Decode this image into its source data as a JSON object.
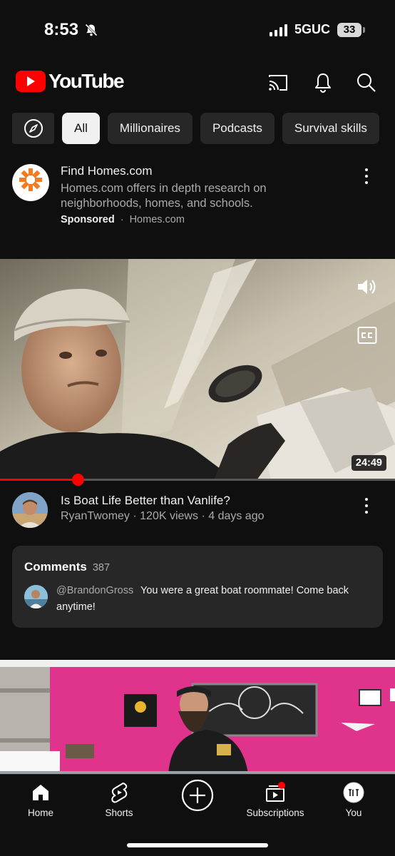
{
  "status_bar": {
    "time": "8:53",
    "network": "5GUC",
    "battery": "33"
  },
  "header": {
    "logo_text": "YouTube",
    "icons": [
      "cast-icon",
      "bell-icon",
      "search-icon"
    ]
  },
  "chips": [
    {
      "label": "All",
      "selected": true
    },
    {
      "label": "Millionaires",
      "selected": false
    },
    {
      "label": "Podcasts",
      "selected": false
    },
    {
      "label": "Survival skills",
      "selected": false
    }
  ],
  "ad": {
    "title": "Find Homes.com",
    "description": "Homes.com offers in depth research on neighborhoods, homes, and schools.",
    "sponsored_label": "Sponsored",
    "separator": "·",
    "domain": "Homes.com"
  },
  "video": {
    "duration": "24:49",
    "progress": 0.19,
    "title": "Is Boat Life Better than Vanlife?",
    "channel": "RyanTwomey",
    "views": "120K views",
    "age": "4 days ago",
    "icons": [
      "volume-icon",
      "closed-captions-icon"
    ]
  },
  "comments": {
    "title": "Comments",
    "count": "387",
    "top_comment": {
      "user": "@BrandonGross",
      "text": "You were a great boat roommate! Come back anytime!"
    }
  },
  "bottom_nav": [
    {
      "label": "Home",
      "icon": "home-icon",
      "active": true
    },
    {
      "label": "Shorts",
      "icon": "shorts-icon"
    },
    {
      "label": "",
      "icon": "create-icon"
    },
    {
      "label": "Subscriptions",
      "icon": "subscriptions-icon"
    },
    {
      "label": "You",
      "icon": "profile-icon"
    }
  ],
  "colors": {
    "background": "#0f0f0f",
    "chip": "#272727",
    "brand_red": "#ff0000",
    "secondary_text": "#aaaaaa"
  }
}
